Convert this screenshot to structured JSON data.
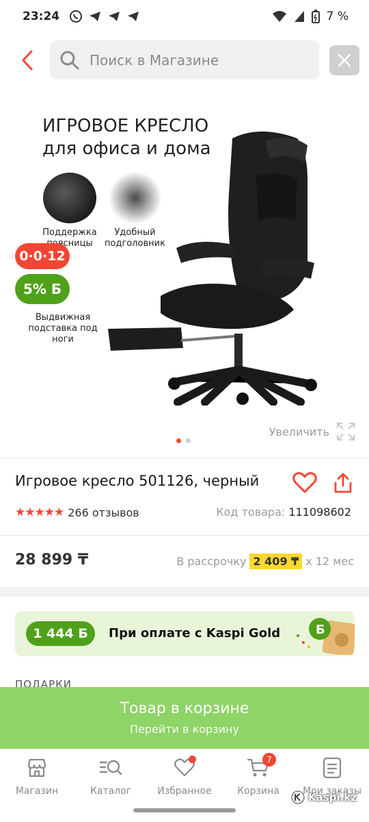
{
  "status_bar": {
    "time": "23:24",
    "battery": "7 %"
  },
  "search": {
    "placeholder": "Поиск в Магазине"
  },
  "gallery": {
    "promo_title_line1": "ИГРОВОЕ КРЕСЛО",
    "promo_title_line2": "для офиса и дома",
    "features": [
      {
        "label": "Поддержка\nпоясницы"
      },
      {
        "label": "Удобный\nподголовник"
      },
      {
        "label": "Выдвижная\nподставка под\nноги"
      }
    ],
    "credit_badge": "0·0·12",
    "bonus_badge": "5% Б",
    "zoom_label": "Увеличить",
    "slide_count": 2,
    "active_slide": 1
  },
  "product": {
    "title": "Игровое кресло 501126, черный",
    "rating_stars": 4.5,
    "reviews": "266 отзывов",
    "sku_label": "Код товара:",
    "sku_value": "111098602",
    "price": "28 899 ₸",
    "installment_label": "В рассрочку",
    "installment_value": "2 409 ₸",
    "installment_term": "x 12 мес"
  },
  "kaspi_gold": {
    "bonus": "1 444 Б",
    "text": "При оплате с Kaspi Gold"
  },
  "cart_cta": {
    "main": "Товар в корзине",
    "sub": "Перейти в корзину"
  },
  "bottom_nav": {
    "items": [
      {
        "label": "Магазин",
        "icon": "shop-icon"
      },
      {
        "label": "Каталог",
        "icon": "catalog-icon"
      },
      {
        "label": "Избранное",
        "icon": "heart-icon"
      },
      {
        "label": "Корзина",
        "icon": "cart-icon"
      },
      {
        "label": "Мои заказы",
        "icon": "orders-icon"
      }
    ],
    "cart_badge": "7"
  },
  "watermark": "Kaspi.kz",
  "colors": {
    "accent_red": "#f14635",
    "kaspi_green": "#4fa119",
    "cta_green": "#8ed466",
    "installment_yellow": "#fcd82e"
  }
}
